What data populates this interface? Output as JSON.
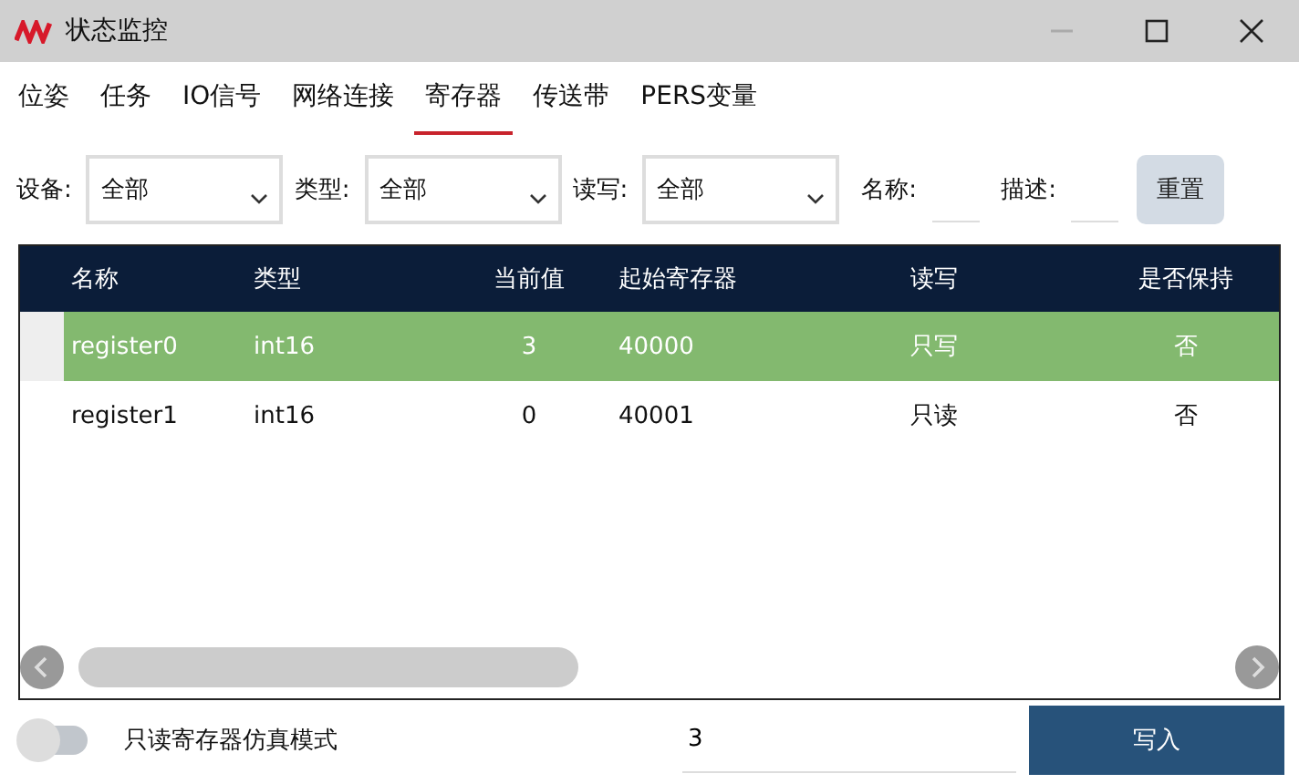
{
  "window": {
    "title": "状态监控"
  },
  "tabs": [
    {
      "label": "位姿",
      "selected": false
    },
    {
      "label": "任务",
      "selected": false
    },
    {
      "label": "IO信号",
      "selected": false
    },
    {
      "label": "网络连接",
      "selected": false
    },
    {
      "label": "寄存器",
      "selected": true
    },
    {
      "label": "传送带",
      "selected": false
    },
    {
      "label": "PERS变量",
      "selected": false
    }
  ],
  "filters": [
    {
      "kind": "select",
      "label": "设备:",
      "value": "全部"
    },
    {
      "kind": "select",
      "label": "类型:",
      "value": "全部"
    },
    {
      "kind": "select",
      "label": "读写:",
      "value": "全部"
    },
    {
      "kind": "text",
      "label": "名称:"
    },
    {
      "kind": "text",
      "label": "描述:"
    }
  ],
  "reset_button": "重置",
  "table": {
    "columns": [
      "名称",
      "类型",
      "当前值",
      "起始寄存器",
      "读写",
      "是否保持"
    ],
    "rows": [
      {
        "cells": [
          "register0",
          "int16",
          "3",
          "40000",
          "只写",
          "否"
        ],
        "selected": true
      },
      {
        "cells": [
          "register1",
          "int16",
          "0",
          "40001",
          "只读",
          "否"
        ],
        "selected": false
      }
    ]
  },
  "simulation_toggle": {
    "label": "只读寄存器仿真模式",
    "on": false
  },
  "write_field": {
    "value": "3"
  },
  "write_button": "写入"
}
